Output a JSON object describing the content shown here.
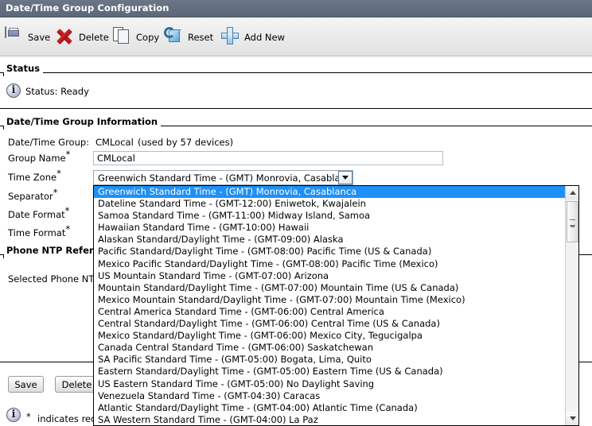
{
  "window": {
    "title": "Date/Time Group Configuration"
  },
  "toolbar": {
    "items": [
      {
        "label": "Save",
        "icon": "save-icon"
      },
      {
        "label": "Delete",
        "icon": "delete-icon"
      },
      {
        "label": "Copy",
        "icon": "copy-icon"
      },
      {
        "label": "Reset",
        "icon": "reset-icon"
      },
      {
        "label": "Add New",
        "icon": "add-new-icon"
      }
    ]
  },
  "status_section": {
    "legend": "Status",
    "icon": "info-icon",
    "text": "Status: Ready"
  },
  "info_section": {
    "legend": "Date/Time Group Information",
    "group_label": "Date/Time Group:",
    "group_value": "CMLocal",
    "group_usage": "(used by 57 devices)",
    "fields": [
      {
        "label": "Group Name",
        "required": "*"
      },
      {
        "label": "Time Zone",
        "required": "*"
      },
      {
        "label": "Separator",
        "required": "*"
      },
      {
        "label": "Date Format",
        "required": "*"
      },
      {
        "label": "Time Format",
        "required": "*"
      }
    ],
    "group_name_input": {
      "value": "CMLocal",
      "placeholder": ""
    },
    "time_zone_select": {
      "value": "Greenwich Standard Time - (GMT) Monrovia, Casablanca",
      "arrow_icon": "chevron-down-icon",
      "expanded": true,
      "options": [
        "Greenwich Standard Time - (GMT) Monrovia, Casablanca",
        "Dateline Standard Time - (GMT-12:00) Eniwetok, Kwajalein",
        "Samoa Standard Time - (GMT-11:00) Midway Island, Samoa",
        "Hawaiian Standard Time - (GMT-10:00) Hawaii",
        "Alaskan Standard/Daylight Time - (GMT-09:00) Alaska",
        "Pacific Standard/Daylight Time - (GMT-08:00) Pacific Time (US & Canada)",
        "Mexico Pacific Standard/Daylight Time - (GMT-08:00) Pacific Time (Mexico)",
        "US Mountain Standard Time - (GMT-07:00) Arizona",
        "Mountain Standard/Daylight Time - (GMT-07:00) Mountain Time (US & Canada)",
        "Mexico Mountain Standard/Daylight Time - (GMT-07:00) Mountain Time (Mexico)",
        "Central America Standard Time - (GMT-06:00) Central America",
        "Central Standard/Daylight Time - (GMT-06:00) Central Time (US & Canada)",
        "Mexico Standard/Daylight Time - (GMT-06:00) Mexico City, Tegucigalpa",
        "Canada Central Standard Time - (GMT-06:00) Saskatchewan",
        "SA Pacific Standard Time - (GMT-05:00) Bogata, Lima, Quito",
        "Eastern Standard/Daylight Time - (GMT-05:00) Eastern Time (US & Canada)",
        "US Eastern Standard Time - (GMT-05:00) No Daylight Saving",
        "Venezuela Standard Time - (GMT-04:30) Caracas",
        "Atlantic Standard/Daylight Time - (GMT-04:00) Atlantic Time (Canada)",
        "SA Western Standard Time - (GMT-04:00) La Paz"
      ],
      "selected_index": 0
    }
  },
  "ntp_section": {
    "legend": "Phone NTP Reference Information",
    "selected_label": "Selected Phone NTP References"
  },
  "footer": {
    "buttons": [
      {
        "label": "Save"
      },
      {
        "label": "Delete"
      }
    ],
    "icon": "info-icon",
    "required_note": "*",
    "required_text": "indicates required item"
  }
}
